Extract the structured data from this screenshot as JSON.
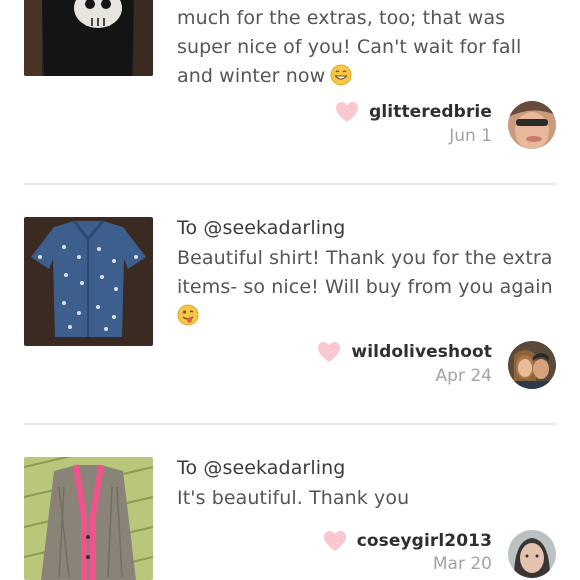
{
  "reviews": [
    {
      "text_lines": [
        "much for the extras, too; that was",
        "super nice of you! Can't wait for fall",
        "and winter now"
      ],
      "emoji": "grinning-face",
      "user": "glitteredbrie",
      "date": "Jun 1",
      "thumb": "black-skull-top"
    },
    {
      "to": "To @seekadarling",
      "text_lines": [
        "Beautiful shirt! Thank you for the extra",
        "items- so nice! Will buy from you again"
      ],
      "emoji": "winking-tongue-face",
      "user": "wildoliveshoot",
      "date": "Apr 24",
      "thumb": "blue-printed-shirt"
    },
    {
      "to": "To @seekadarling",
      "text_lines": [
        "It's beautiful. Thank you"
      ],
      "user": "coseygirl2013",
      "date": "Mar 20",
      "thumb": "grey-pink-cardigan"
    }
  ],
  "colors": {
    "heart": "#f9c7cf",
    "divider": "#e9e9e9",
    "date": "#a3a3a3"
  }
}
